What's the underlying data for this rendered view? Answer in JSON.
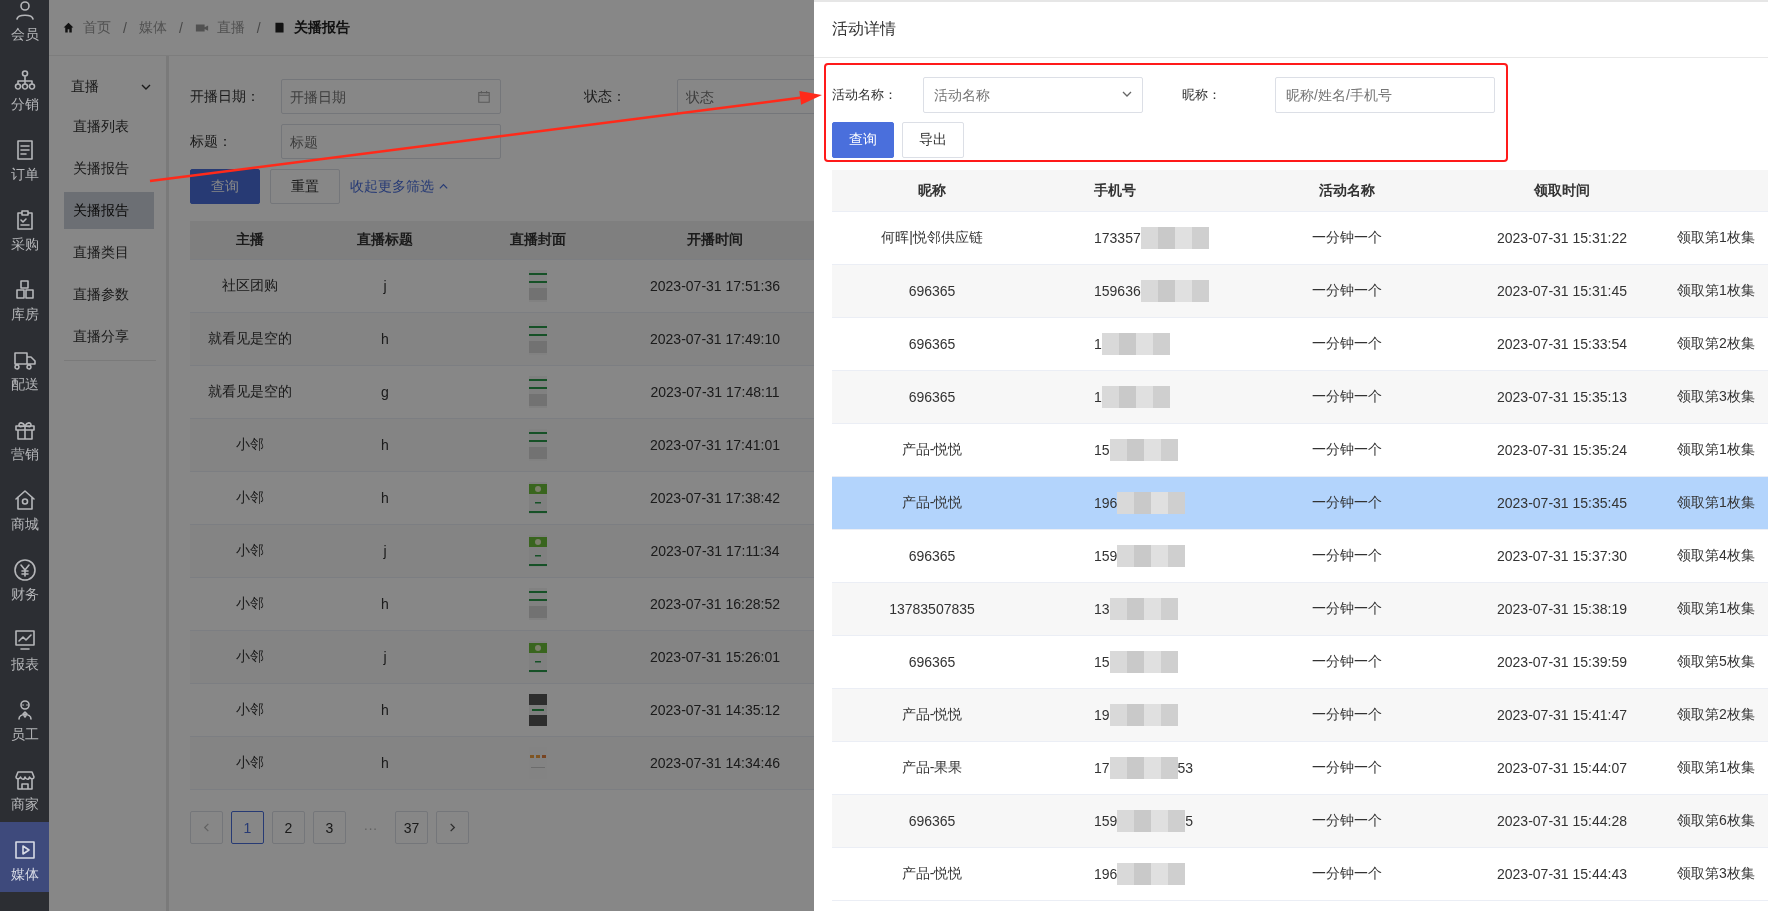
{
  "sidebar": {
    "items": [
      {
        "label": "会员",
        "selected": false
      },
      {
        "label": "分销",
        "selected": false
      },
      {
        "label": "订单",
        "selected": false
      },
      {
        "label": "采购",
        "selected": false
      },
      {
        "label": "库房",
        "selected": false
      },
      {
        "label": "配送",
        "selected": false
      },
      {
        "label": "营销",
        "selected": false
      },
      {
        "label": "商城",
        "selected": false
      },
      {
        "label": "财务",
        "selected": false
      },
      {
        "label": "报表",
        "selected": false
      },
      {
        "label": "员工",
        "selected": false
      },
      {
        "label": "商家",
        "selected": false
      },
      {
        "label": "媒体",
        "selected": true
      }
    ]
  },
  "breadcrumb": {
    "separator": "/",
    "items": [
      {
        "label": "首页",
        "current": false
      },
      {
        "label": "媒体",
        "current": false
      },
      {
        "label": "直播",
        "current": false
      },
      {
        "label": "关播报告",
        "current": true
      }
    ]
  },
  "submenu": {
    "title": "直播",
    "expanded": true,
    "items": [
      {
        "label": "直播列表",
        "selected": false
      },
      {
        "label": "关播报告",
        "selected": false
      },
      {
        "label": "关播报告",
        "selected": true
      },
      {
        "label": "直播类目",
        "selected": false
      },
      {
        "label": "直播参数",
        "selected": false
      },
      {
        "label": "直播分享",
        "selected": false
      }
    ]
  },
  "filters": [
    {
      "label": "开播日期：",
      "placeholder": "开播日期",
      "kind": "date"
    },
    {
      "label": "状态：",
      "placeholder": "状态",
      "kind": "select"
    },
    {
      "label": "标题：",
      "placeholder": "标题",
      "kind": "text"
    }
  ],
  "actions": {
    "query": "查询",
    "reset": "重置",
    "toggle": "收起更多筛选"
  },
  "table": {
    "columns": [
      "主播",
      "直播标题",
      "直播封面",
      "开播时间"
    ],
    "rows": [
      {
        "anchor": "社区团购",
        "title": "j",
        "time": "2023-07-31 17:51:36"
      },
      {
        "anchor": "就看见是空的",
        "title": "h",
        "time": "2023-07-31 17:49:10"
      },
      {
        "anchor": "就看见是空的",
        "title": "g",
        "time": "2023-07-31 17:48:11"
      },
      {
        "anchor": "小邻",
        "title": "h",
        "time": "2023-07-31 17:41:01"
      },
      {
        "anchor": "小邻",
        "title": "h",
        "time": "2023-07-31 17:38:42"
      },
      {
        "anchor": "小邻",
        "title": "j",
        "time": "2023-07-31 17:11:34"
      },
      {
        "anchor": "小邻",
        "title": "h",
        "time": "2023-07-31 16:28:52"
      },
      {
        "anchor": "小邻",
        "title": "j",
        "time": "2023-07-31 15:26:01"
      },
      {
        "anchor": "小邻",
        "title": "h",
        "time": "2023-07-31 14:35:12"
      },
      {
        "anchor": "小邻",
        "title": "h",
        "time": "2023-07-31 14:34:46"
      }
    ]
  },
  "pagination": {
    "ellipsis": "···",
    "pages": [
      {
        "label": "1",
        "selected": true
      },
      {
        "label": "2",
        "selected": false
      },
      {
        "label": "3",
        "selected": false
      },
      {
        "label": "37",
        "selected": false
      }
    ]
  },
  "drawer": {
    "title": "活动详情",
    "filters": [
      {
        "label": "活动名称：",
        "placeholder": "活动名称",
        "kind": "select"
      },
      {
        "label": "昵称：",
        "placeholder": "昵称/姓名/手机号",
        "kind": "text"
      }
    ],
    "buttons": [
      {
        "label": "查询",
        "kind": "primary"
      },
      {
        "label": "导出",
        "kind": "default"
      }
    ],
    "table": {
      "columns": [
        "昵称",
        "手机号",
        "活动名称",
        "领取时间"
      ],
      "rows": [
        {
          "nickname": "何晖|悦邻供应链",
          "phone": "173357",
          "activity": "一分钟一个",
          "time": "2023-07-31 15:31:22",
          "column_5": "领取第1枚集",
          "selected": false
        },
        {
          "nickname": "696365",
          "phone": "159636",
          "activity": "一分钟一个",
          "time": "2023-07-31 15:31:45",
          "column_5": "领取第1枚集",
          "selected": false
        },
        {
          "nickname": "696365",
          "phone": "1",
          "activity": "一分钟一个",
          "time": "2023-07-31 15:33:54",
          "column_5": "领取第2枚集",
          "selected": false
        },
        {
          "nickname": "696365",
          "phone": "1",
          "activity": "一分钟一个",
          "time": "2023-07-31 15:35:13",
          "column_5": "领取第3枚集",
          "selected": false
        },
        {
          "nickname": "产品-悦悦",
          "phone": "15",
          "activity": "一分钟一个",
          "time": "2023-07-31 15:35:24",
          "column_5": "领取第1枚集",
          "selected": false
        },
        {
          "nickname": "产品-悦悦",
          "phone": "196",
          "activity": "一分钟一个",
          "time": "2023-07-31 15:35:45",
          "column_5": "领取第1枚集",
          "selected": true
        },
        {
          "nickname": "696365",
          "phone": "159",
          "activity": "一分钟一个",
          "time": "2023-07-31 15:37:30",
          "column_5": "领取第4枚集",
          "selected": false
        },
        {
          "nickname": "13783507835",
          "phone": "13",
          "activity": "一分钟一个",
          "time": "2023-07-31 15:38:19",
          "column_5": "领取第1枚集",
          "selected": false
        },
        {
          "nickname": "696365",
          "phone": "15",
          "activity": "一分钟一个",
          "time": "2023-07-31 15:39:59",
          "column_5": "领取第5枚集",
          "selected": false
        },
        {
          "nickname": "产品-悦悦",
          "phone": "19",
          "activity": "一分钟一个",
          "time": "2023-07-31 15:41:47",
          "column_5": "领取第2枚集",
          "selected": false
        },
        {
          "nickname": "产品-果果",
          "phone": "17",
          "phone_end": "53",
          "activity": "一分钟一个",
          "time": "2023-07-31 15:44:07",
          "column_5": "领取第1枚集",
          "selected": false
        },
        {
          "nickname": "696365",
          "phone": "159",
          "phone_end": "5",
          "activity": "一分钟一个",
          "time": "2023-07-31 15:44:28",
          "column_5": "领取第6枚集",
          "selected": false
        },
        {
          "nickname": "产品-悦悦",
          "phone": "196",
          "activity": "一分钟一个",
          "time": "2023-07-31 15:44:43",
          "column_5": "领取第3枚集",
          "selected": false
        }
      ]
    }
  }
}
